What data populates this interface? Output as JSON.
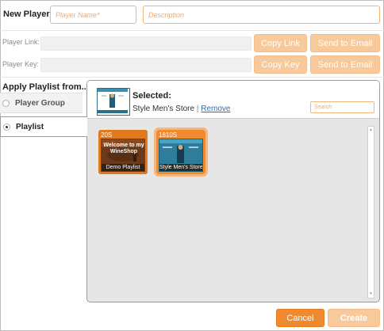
{
  "header": {
    "title": "New Player",
    "name_placeholder": "Player Name*",
    "description_placeholder": "Description"
  },
  "link_row": {
    "label": "Player Link:",
    "value": "",
    "copy_label": "Copy Link",
    "email_label": "Send to Email"
  },
  "key_row": {
    "label": "Player Key:",
    "value": "",
    "copy_label": "Copy Key",
    "email_label": "Send to Email"
  },
  "apply": {
    "title": "Apply Playlist from...",
    "options": [
      {
        "label": "Player Group",
        "selected": false
      },
      {
        "label": "Playlist",
        "selected": true
      }
    ]
  },
  "selected": {
    "title": "Selected:",
    "name": "Style Men's Store",
    "divider": "|",
    "remove_label": "Remove",
    "search_placeholder": "Search"
  },
  "playlists": [
    {
      "duration": "20S",
      "thumb_text": "Welcome to my WineShop",
      "caption": "Demo Playlist",
      "selected": false
    },
    {
      "duration": "1810S",
      "thumb_text": "",
      "caption": "Style Men's Store",
      "selected": true
    }
  ],
  "footer": {
    "cancel_label": "Cancel",
    "create_label": "Create"
  },
  "colors": {
    "accent": "#f08a2e",
    "accent_disabled": "#f8c99b",
    "input_border": "#f2b57a",
    "link": "#2d6dbd"
  }
}
